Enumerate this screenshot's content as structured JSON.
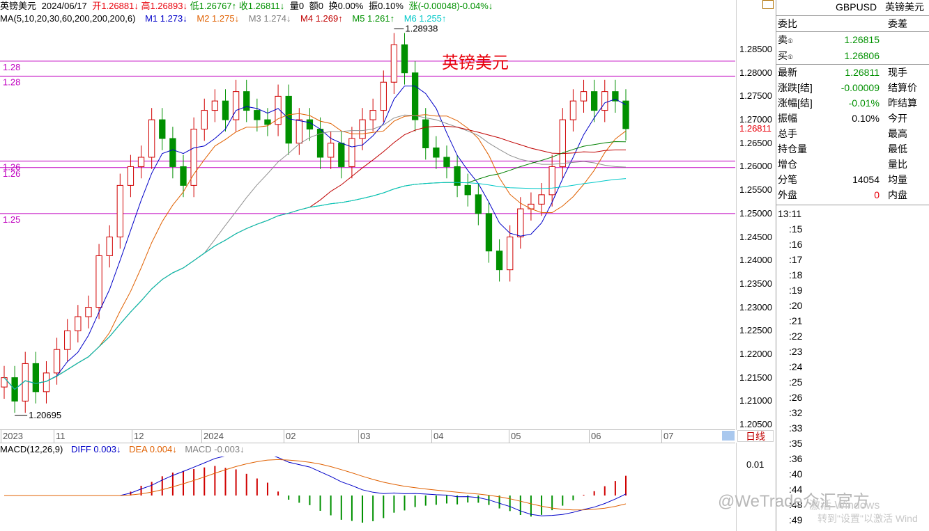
{
  "header": {
    "name": "英镑美元",
    "date": "2024/06/17",
    "open": "开1.26881↓",
    "high": "高1.26893↓",
    "low": "低1.26767↑",
    "close": "收1.26811↓",
    "volume": "量0",
    "amount": "额0",
    "turnover": "换0.00%",
    "amplitude": "振0.10%",
    "change": "涨(-0.00048)-0.04%↓"
  },
  "ma_header": {
    "params": "MA(5,10,20,30,60,200,200,200,6)",
    "m1": "M1 1.273↓",
    "m2": "M2 1.275↓",
    "m3": "M3 1.274↓",
    "m4": "M4 1.269↑",
    "m5": "M5 1.261↑",
    "m6": "M6 1.255↑"
  },
  "chart_title": "英镑美元",
  "annotations": {
    "high_label": "1.28938",
    "low_label": "1.20695",
    "current_price": "1.26811"
  },
  "hlines": [
    {
      "label": "1.28",
      "value": 1.2825
    },
    {
      "label": "1.28",
      "value": 1.2793
    },
    {
      "label": "1.26",
      "value": 1.2612
    },
    {
      "label": "1.26",
      "value": 1.2598
    },
    {
      "label": "1.25",
      "value": 1.25
    }
  ],
  "price_axis": [
    "1.28500",
    "1.28000",
    "1.27500",
    "1.27000",
    "1.26500",
    "1.26000",
    "1.25500",
    "1.25000",
    "1.24500",
    "1.24000",
    "1.23500",
    "1.23000",
    "1.22500",
    "1.22000",
    "1.21500",
    "1.21000",
    "1.20500"
  ],
  "time_axis": [
    "2023",
    "11",
    "12",
    "2024",
    "02",
    "03",
    "04",
    "05",
    "06",
    "07"
  ],
  "daily_button": "日线",
  "macd": {
    "title": "MACD(12,26,9)",
    "diff": "DIFF 0.003↓",
    "dea": "DEA 0.004↓",
    "macd": "MACD -0.003↓",
    "axis_label": "0.01"
  },
  "right_panel": {
    "symbol": "GBPUSD",
    "name": "英镑美元",
    "weibi_label": "委比",
    "weicha_label": "委差",
    "sell_label": "卖",
    "sell_value": "1.26815",
    "buy_label": "买",
    "buy_value": "1.26806",
    "rows": [
      {
        "l": "最新",
        "v": "1.26811",
        "r": "现手"
      },
      {
        "l": "涨跌[结]",
        "v": "-0.00009",
        "r": "结算价"
      },
      {
        "l": "涨幅[结]",
        "v": "-0.01%",
        "r": "昨结算"
      },
      {
        "l": "振幅",
        "v": "0.10%",
        "r": "今开"
      },
      {
        "l": "总手",
        "v": "",
        "r": "最高"
      },
      {
        "l": "持仓量",
        "v": "",
        "r": "最低"
      },
      {
        "l": "增仓",
        "v": "",
        "r": "量比"
      },
      {
        "l": "分笔",
        "v": "14054",
        "r": "均量"
      },
      {
        "l": "外盘",
        "v": "0",
        "r": "内盘"
      }
    ],
    "ticks": [
      "13:11",
      ":15",
      ":16",
      ":17",
      ":18",
      ":19",
      ":20",
      ":21",
      ":22",
      ":23",
      ":24",
      ":25",
      ":26",
      ":32",
      ":33",
      ":35",
      ":36",
      ":40",
      ":44",
      ":48",
      ":49"
    ]
  },
  "overlays": {
    "watermark": "@WeTrade众汇官方",
    "activate_line1": "激活 Windows",
    "activate_line2": "转到\"设置\"以激活 Wind"
  },
  "chart_data": {
    "type": "candlestick",
    "symbol": "GBPUSD",
    "period": "daily",
    "ylim": [
      1.2045,
      1.2905
    ],
    "series_close": [
      1.215,
      1.21,
      1.218,
      1.212,
      1.216,
      1.221,
      1.225,
      1.228,
      1.23,
      1.241,
      1.245,
      1.256,
      1.26,
      1.262,
      1.27,
      1.266,
      1.26,
      1.256,
      1.268,
      1.272,
      1.274,
      1.27,
      1.276,
      1.272,
      1.27,
      1.269,
      1.275,
      1.265,
      1.27,
      1.268,
      1.262,
      1.265,
      1.26,
      1.266,
      1.27,
      1.272,
      1.278,
      1.286,
      1.28,
      1.27,
      1.264,
      1.262,
      1.26,
      1.256,
      1.254,
      1.25,
      1.242,
      1.238,
      1.245,
      1.251,
      1.252,
      1.254,
      1.26,
      1.27,
      1.274,
      1.276,
      1.272,
      1.276,
      1.274,
      1.2681
    ],
    "ma_values": {
      "M1": 1.273,
      "M2": 1.275,
      "M3": 1.274,
      "M4": 1.269,
      "M5": 1.261,
      "M6": 1.255
    },
    "macd": {
      "diff": 0.003,
      "dea": 0.004,
      "macd": -0.003
    }
  }
}
